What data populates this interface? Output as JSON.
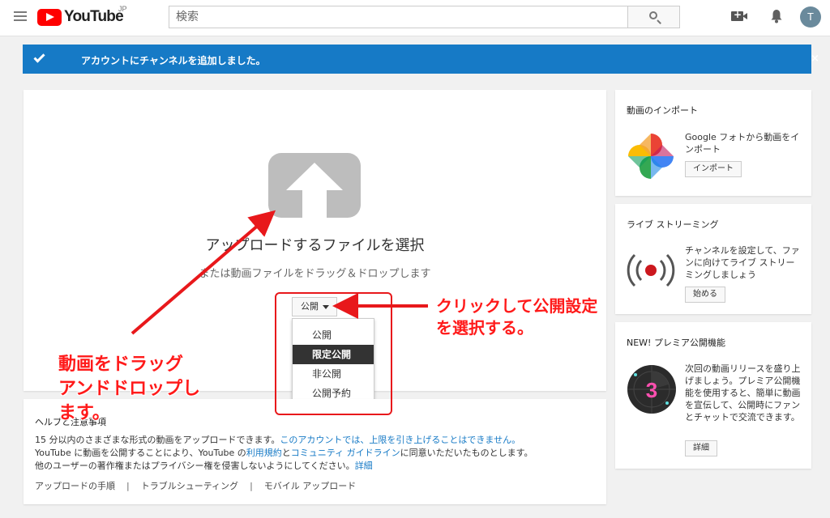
{
  "header": {
    "logo_text": "YouTube",
    "logo_region": "JP",
    "search_placeholder": "検索",
    "avatar_initial": "T"
  },
  "banner": {
    "message": "アカウントにチャンネルを追加しました。",
    "close": "×"
  },
  "upload": {
    "title": "アップロードするファイルを選択",
    "subtitle": "または動画ファイルをドラッグ＆ドロップします",
    "privacy_selected": "公開",
    "privacy_options": [
      "公開",
      "限定公開",
      "非公開",
      "公開予約"
    ],
    "privacy_highlighted": "限定公開"
  },
  "help": {
    "title": "ヘルプと注意事項",
    "line1_text": "15 分以内のさまざまな形式の動画をアップロードできます。",
    "line1_link": "このアカウントでは、上限を引き上げることはできません。",
    "line2_a": "YouTube に動画を公開することにより、YouTube の",
    "line2_link1": "利用規約",
    "line2_b": "と",
    "line2_link2": "コミュニティ ガイドライン",
    "line2_c": "に同意いただいたものとします。",
    "line3_text": "他のユーザーの著作権またはプライバシー権を侵害しないようにしてください。",
    "line3_link": "詳細",
    "links": [
      "アップロードの手順",
      "トラブルシューティング",
      "モバイル アップロード"
    ]
  },
  "sidebar": {
    "import": {
      "title": "動画のインポート",
      "text": "Google フォトから動画をインポート",
      "button": "インポート"
    },
    "live": {
      "title": "ライブ ストリーミング",
      "text": "チャンネルを設定して、ファンに向けてライブ ストリーミングしましょう",
      "button": "始める"
    },
    "premiere": {
      "title": "NEW! プレミア公開機能",
      "text": "次回の動画リリースを盛り上げましょう。プレミア公開機能を使用すると、簡単に動画を宣伝して、公開時にファンとチャットで交流できます。",
      "button": "詳細",
      "badge": "3"
    }
  },
  "annotations": {
    "right_line1": "クリックして公開設定",
    "right_line2": "を選択する。",
    "left_line1": "動画をドラッグ",
    "left_line2": "アンドドロップし",
    "left_line3": "ます。"
  },
  "colors": {
    "banner": "#167ac6",
    "annotation": "#ff1a1a",
    "youtube_red": "#ff0000"
  }
}
